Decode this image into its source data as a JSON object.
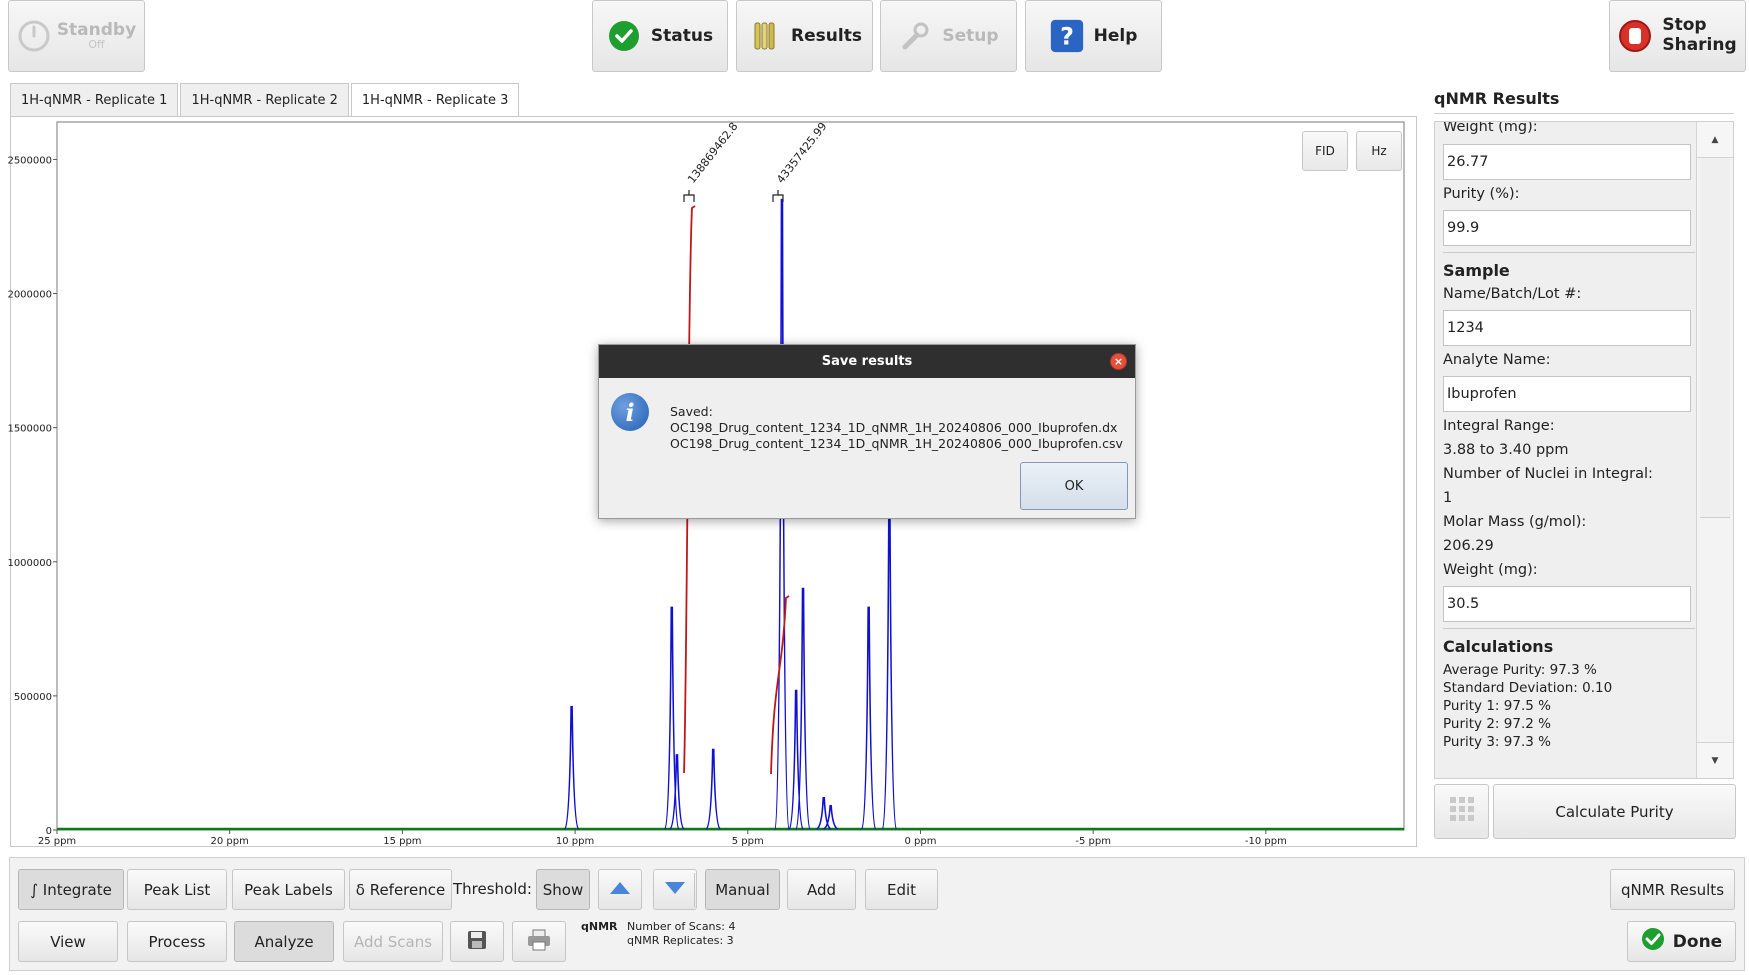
{
  "header": {
    "standby": {
      "label": "Standby",
      "sub": "Off"
    },
    "status": "Status",
    "results": "Results",
    "setup": "Setup",
    "help": "Help",
    "stop_sharing": [
      "Stop",
      "Sharing"
    ]
  },
  "tabs": [
    {
      "label": "1H-qNMR - Replicate 1"
    },
    {
      "label": "1H-qNMR - Replicate 2"
    },
    {
      "label": "1H-qNMR - Replicate 3"
    }
  ],
  "plot": {
    "fid_label": "FID",
    "hz_label": "Hz",
    "y_ticks": [
      "2500000",
      "2000000",
      "1500000",
      "1000000",
      "500000",
      "0"
    ],
    "x_ticks": [
      "25 ppm",
      "20 ppm",
      "15 ppm",
      "10 ppm",
      "5 ppm",
      "0 ppm",
      "-5 ppm",
      "-10 ppm"
    ],
    "integral_labels": [
      "138869462.8",
      "43357425.99"
    ],
    "colors": {
      "spectrum": "#1010d0",
      "integral": "#c01818",
      "baseline": "#0a7a1a"
    }
  },
  "chart_data": {
    "type": "line",
    "xlabel": "",
    "ylabel": "",
    "xlim": [
      25,
      -14
    ],
    "ylim": [
      0,
      2600000
    ],
    "peaks_ppm": [
      10.1,
      7.2,
      7.05,
      4.01,
      6.0,
      3.6,
      3.4,
      2.8,
      2.6,
      1.5,
      0.9
    ],
    "peak_heights": [
      460000,
      830000,
      280000,
      2350000,
      300000,
      520000,
      900000,
      120000,
      90000,
      830000,
      1250000
    ],
    "integrals": [
      {
        "label": "138869462.8",
        "from_ppm": 4.2,
        "to_ppm": 3.8
      },
      {
        "label": "43357425.99",
        "from_ppm": 1.6,
        "to_ppm": 1.2
      }
    ]
  },
  "dialog": {
    "title": "Save results",
    "lines": [
      "Saved:",
      "OC198_Drug_content_1234_1D_qNMR_1H_20240806_000_Ibuprofen.dx",
      "OC198_Drug_content_1234_1D_qNMR_1H_20240806_000_Ibuprofen.csv"
    ],
    "ok": "OK"
  },
  "panel": {
    "title": "qNMR Results",
    "weight_label_top": "Weight (mg):",
    "weight_top": "26.77",
    "purity_label": "Purity (%):",
    "purity": "99.9",
    "sample_head": "Sample",
    "name_label": "Name/Batch/Lot #:",
    "name": "1234",
    "analyte_label": "Analyte Name:",
    "analyte": "Ibuprofen",
    "range_label": "Integral Range:",
    "range": "3.88 to 3.40 ppm",
    "nuclei_label": "Number of Nuclei in Integral:",
    "nuclei": "1",
    "molar_label": "Molar Mass (g/mol):",
    "molar": "206.29",
    "weight_label": "Weight (mg):",
    "weight": "30.5",
    "calc_head": "Calculations",
    "calcs": [
      "Average Purity: 97.3 %",
      "Standard Deviation: 0.10",
      "Purity 1: 97.5 %",
      "Purity 2: 97.2 %",
      "Purity 3: 97.3 %"
    ],
    "calc_button": "Calculate Purity"
  },
  "toolbar": {
    "integrate": "∫ Integrate",
    "peak_list": "Peak List",
    "peak_labels": "Peak Labels",
    "reference": "δ Reference",
    "threshold_label": "Threshold:",
    "show": "Show",
    "manual": "Manual",
    "add": "Add",
    "edit": "Edit",
    "qnmr_results": "qNMR Results",
    "view": "View",
    "process": "Process",
    "analyze": "Analyze",
    "add_scans": "Add Scans",
    "qnmr_tag": "qNMR",
    "scans": "Number of Scans:  4",
    "replicates": "qNMR Replicates:  3",
    "done": "Done"
  }
}
